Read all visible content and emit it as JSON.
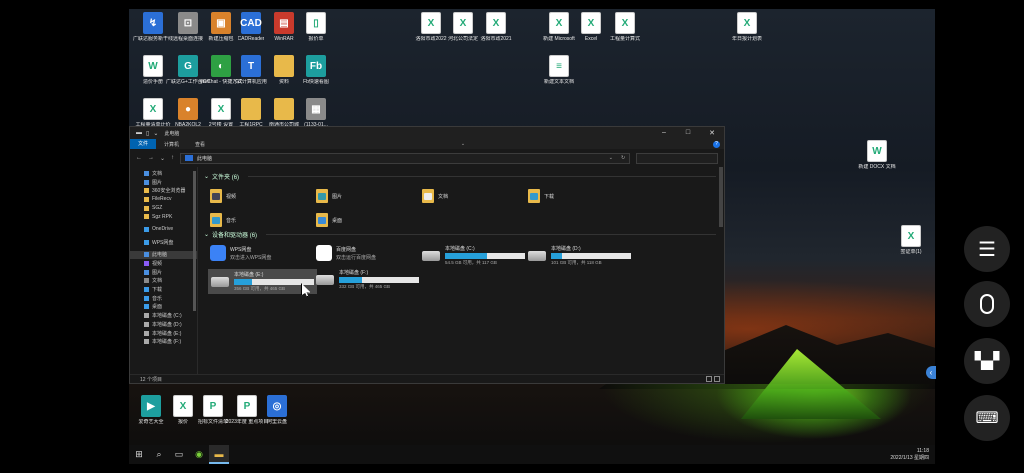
{
  "desktop": {
    "icons": [
      {
        "id": "d1",
        "label": "广联达服务新干线",
        "color": "blue",
        "glyph": "↯"
      },
      {
        "id": "d2",
        "label": "远程桌面连接",
        "color": "gray",
        "glyph": "⊡"
      },
      {
        "id": "d3",
        "label": "新建压缩包",
        "color": "orange",
        "glyph": "▣"
      },
      {
        "id": "d4",
        "label": "CADReader",
        "color": "blue",
        "glyph": "CAD"
      },
      {
        "id": "d5",
        "label": "WinRAR",
        "color": "red",
        "glyph": "▤"
      },
      {
        "id": "d6",
        "label": "报价单",
        "color": "doc",
        "glyph": "▯"
      },
      {
        "id": "d7",
        "label": "造价手册",
        "color": "doc",
        "glyph": "W"
      },
      {
        "id": "d8",
        "label": "广联达G+工作台GWS",
        "color": "teal",
        "glyph": "G"
      },
      {
        "id": "d9",
        "label": "WeChat - 快捷方式",
        "color": "green",
        "glyph": "◐"
      },
      {
        "id": "d10",
        "label": "G2计算机应用",
        "color": "blue",
        "glyph": "T"
      },
      {
        "id": "d11",
        "label": "资料",
        "color": "folder",
        "glyph": ""
      },
      {
        "id": "d12",
        "label": "Fb快速看图",
        "color": "teal",
        "glyph": "Fb"
      },
      {
        "id": "d13",
        "label": "工程量清单计价",
        "color": "doc",
        "glyph": "X"
      },
      {
        "id": "d14",
        "label": "NBA2KOL2",
        "color": "orange",
        "glyph": "●"
      },
      {
        "id": "d15",
        "label": "2号楼 设置",
        "color": "doc",
        "glyph": "X"
      },
      {
        "id": "d16",
        "label": "工程1RPC",
        "color": "folder",
        "glyph": ""
      },
      {
        "id": "d17",
        "label": "南通市公司城",
        "color": "folder",
        "glyph": ""
      },
      {
        "id": "d18",
        "label": "(1133-01...",
        "color": "gray",
        "glyph": "▦"
      },
      {
        "id": "d19",
        "label": "洛阳市政2022",
        "color": "doc",
        "glyph": "X"
      },
      {
        "id": "d20",
        "label": "河北公司法定",
        "color": "doc",
        "glyph": "X"
      },
      {
        "id": "d21",
        "label": "洛阳市政2021",
        "color": "doc",
        "glyph": "X"
      },
      {
        "id": "d22",
        "label": "新建 Microsoft",
        "color": "doc",
        "glyph": "X"
      },
      {
        "id": "d23",
        "label": "Excel",
        "color": "doc",
        "glyph": "X"
      },
      {
        "id": "d24",
        "label": "工程量计算式",
        "color": "doc",
        "glyph": "X"
      },
      {
        "id": "d25",
        "label": "年日报计划表",
        "color": "doc",
        "glyph": "X"
      },
      {
        "id": "d26",
        "label": "新建文本文档",
        "color": "doc",
        "glyph": "≡"
      },
      {
        "id": "d27",
        "label": "新建 DOCX 文档",
        "color": "doc",
        "glyph": "W"
      },
      {
        "id": "d28",
        "label": "签证单(1)",
        "color": "doc",
        "glyph": "X"
      },
      {
        "id": "d29",
        "label": "爱奇艺大全",
        "color": "teal",
        "glyph": "▶"
      },
      {
        "id": "d30",
        "label": "报价",
        "color": "doc",
        "glyph": "X"
      },
      {
        "id": "d31",
        "label": "招标文件清单",
        "color": "doc",
        "glyph": "P"
      },
      {
        "id": "d32",
        "label": "2023年度 重点项目",
        "color": "doc",
        "glyph": "P"
      },
      {
        "id": "d33",
        "label": "阿里云盘",
        "color": "blue",
        "glyph": "◎"
      }
    ]
  },
  "explorer": {
    "title": "此电脑",
    "ribbon_tabs": [
      "文件",
      "计算机",
      "查看"
    ],
    "address": "此电脑",
    "nav": [
      "文档",
      "图片",
      "360安全浏览器",
      "FileRecv",
      "SGZ",
      "Sgz RPK",
      "OneDrive",
      "WPS网盘",
      "此电脑",
      "视频",
      "图片",
      "文档",
      "下载",
      "音乐",
      "桌面",
      "本地磁盘 (C:)",
      "本地磁盘 (D:)",
      "本地磁盘 (E:)",
      "本地磁盘 (F:)"
    ],
    "folders_header": "文件夹 (6)",
    "folders": [
      "视频",
      "图片",
      "文档",
      "下载",
      "音乐",
      "桌面"
    ],
    "devices_header": "设备和驱动器 (6)",
    "apps": [
      {
        "name": "WPS网盘",
        "sub": "双击进入WPS网盘"
      },
      {
        "name": "百度网盘",
        "sub": "双击运行百度网盘"
      }
    ],
    "drives": [
      {
        "name": "本地磁盘 (C:)",
        "free": "54.5 GB 可用，共 117 GB",
        "used_fraction": 0.53
      },
      {
        "name": "本地磁盘 (D:)",
        "free": "101 GB 可用，共 118 GB",
        "used_fraction": 0.14
      },
      {
        "name": "本地磁盘 (E:)",
        "free": "356 GB 可用，共 465 GB",
        "used_fraction": 0.23
      },
      {
        "name": "本地磁盘 (F:)",
        "free": "332 GB 可用，共 465 GB",
        "used_fraction": 0.29
      }
    ],
    "status": "12 个项目"
  },
  "taskbar": {
    "time": "11:18",
    "date": "2022/1/13 星期四"
  }
}
